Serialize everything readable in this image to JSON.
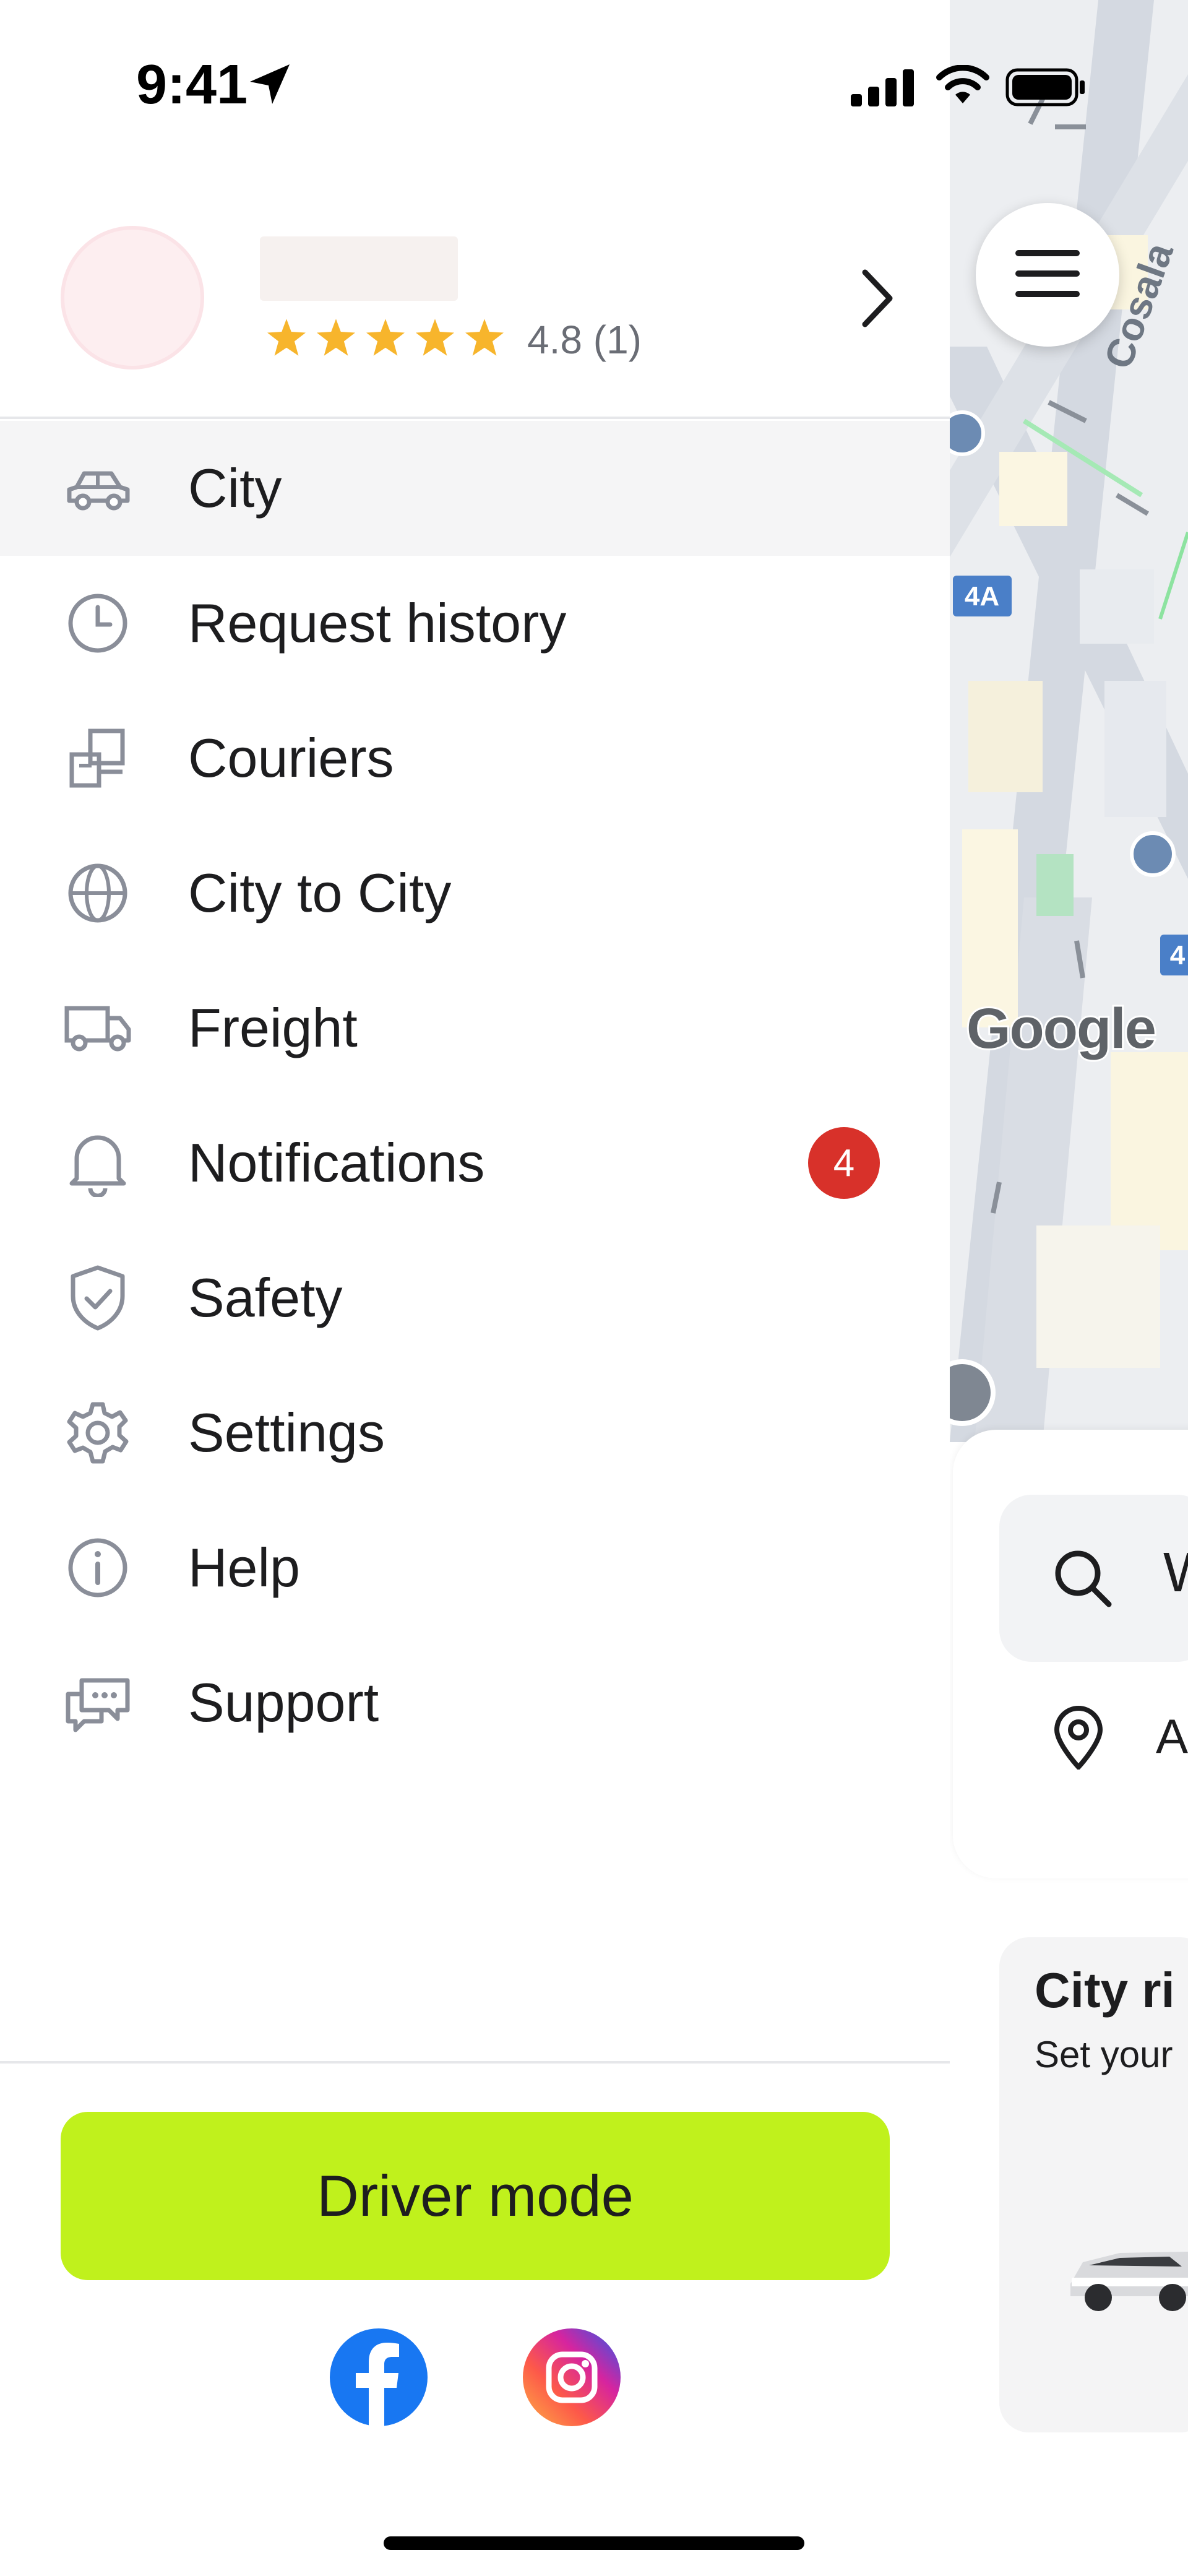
{
  "status_bar": {
    "time": "9:41",
    "icons": [
      "location-arrow-icon",
      "signal-icon",
      "wifi-icon",
      "battery-icon"
    ]
  },
  "profile": {
    "rating": "4.8",
    "rating_count": "(1)",
    "rating_text": "4.8 (1)",
    "stars": 5
  },
  "menu": {
    "items": [
      {
        "label": "City",
        "icon": "car-icon",
        "active": true
      },
      {
        "label": "Request history",
        "icon": "clock-icon"
      },
      {
        "label": "Couriers",
        "icon": "courier-icon"
      },
      {
        "label": "City to City",
        "icon": "globe-icon"
      },
      {
        "label": "Freight",
        "icon": "truck-icon"
      },
      {
        "label": "Notifications",
        "icon": "bell-icon",
        "badge": "4"
      },
      {
        "label": "Safety",
        "icon": "shield-check-icon"
      },
      {
        "label": "Settings",
        "icon": "gear-icon"
      },
      {
        "label": "Help",
        "icon": "info-icon"
      },
      {
        "label": "Support",
        "icon": "chat-icon"
      }
    ]
  },
  "driver_mode_label": "Driver mode",
  "social": [
    "facebook-icon",
    "instagram-icon"
  ],
  "map": {
    "logo_text": "Google",
    "street_label": "Cosala",
    "route_badge": "4A",
    "route_badge_partial": "4"
  },
  "right_panel": {
    "search_text_partial": "W",
    "location_text_partial": "A",
    "ride_title_partial": "City ri",
    "ride_subtitle_partial": "Set your"
  },
  "colors": {
    "accent": "#c0f11c",
    "badge": "#d8312a",
    "star": "#f7b52c",
    "icon_gray": "#8a8e99"
  }
}
